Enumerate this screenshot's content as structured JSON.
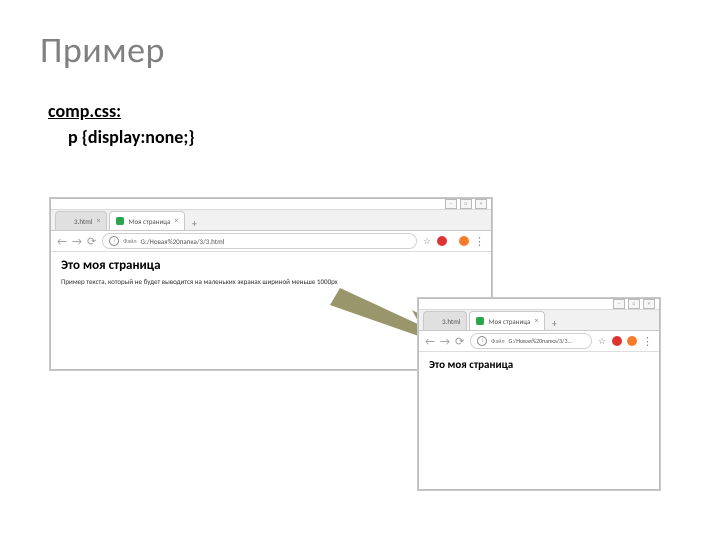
{
  "slide": {
    "title": "Пример",
    "filename": "comp.css:",
    "css_code": "p {display:none;}"
  },
  "large_browser": {
    "tab1_title": "3.html",
    "tab2_title": "Моя страница",
    "url_label": "Файл",
    "url": "G:/Новая%20папка/3/3.html",
    "heading": "Это моя страница",
    "paragraph": "Пример текста, который не будет выводится на маленьких экранах шириной меньше 1000px"
  },
  "small_browser": {
    "tab1_title": "3.html",
    "tab2_title": "Моя страница",
    "url_label": "Файл",
    "url": "G:/Новая%20папка/3/3...",
    "heading": "Это моя страница"
  },
  "icons": {
    "close": "×",
    "plus": "+",
    "back": "←",
    "fwd": "→",
    "reload": "⟳",
    "star": "☆",
    "menu": "⋮",
    "min": "–",
    "max": "□"
  }
}
